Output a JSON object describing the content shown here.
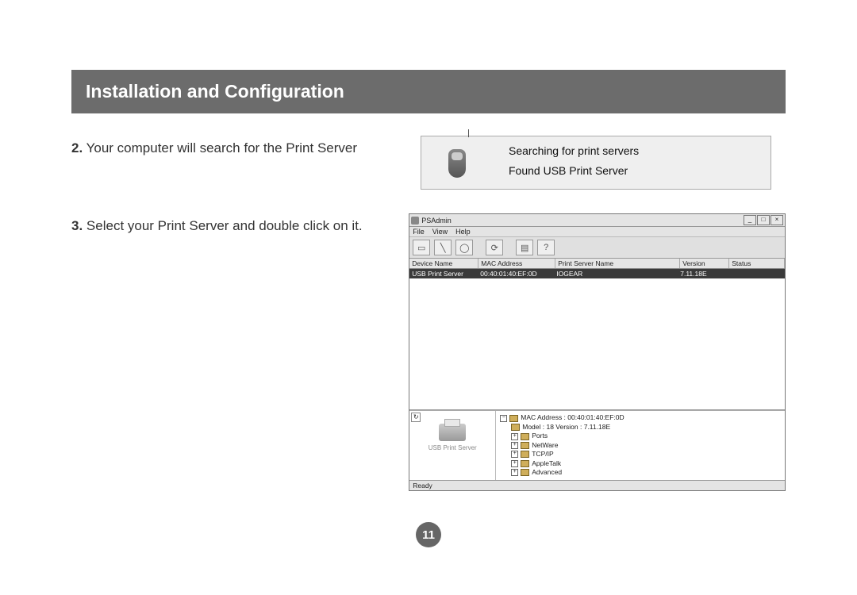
{
  "header": {
    "title": "Installation and Configuration"
  },
  "steps": {
    "step2": {
      "num": "2.",
      "text": "Your computer will search for the Print Server"
    },
    "step3": {
      "num": "3.",
      "text": "Select your Print Server and double click on it."
    }
  },
  "shot1": {
    "line1": "Searching for print servers",
    "line2": "Found USB Print Server"
  },
  "shot2": {
    "title": "PSAdmin",
    "winbtns": {
      "min": "_",
      "max": "□",
      "close": "×"
    },
    "menu": [
      "File",
      "View",
      "Help"
    ],
    "columns": [
      "Device Name",
      "MAC Address",
      "Print Server Name",
      "Version",
      "Status"
    ],
    "row": {
      "device": "USB Print Server",
      "mac": "00:40:01:40:EF:0D",
      "name": "IOGEAR",
      "version": "7.11.18E",
      "status": ""
    },
    "detail": {
      "label": "USB Print Server",
      "macline": "MAC Address : 00:40:01:40:EF:0D",
      "modelline": "Model : 18   Version : 7.11.18E",
      "tree": [
        "Ports",
        "NetWare",
        "TCP/IP",
        "AppleTalk",
        "Advanced"
      ]
    },
    "status": "Ready"
  },
  "page_number": "11"
}
